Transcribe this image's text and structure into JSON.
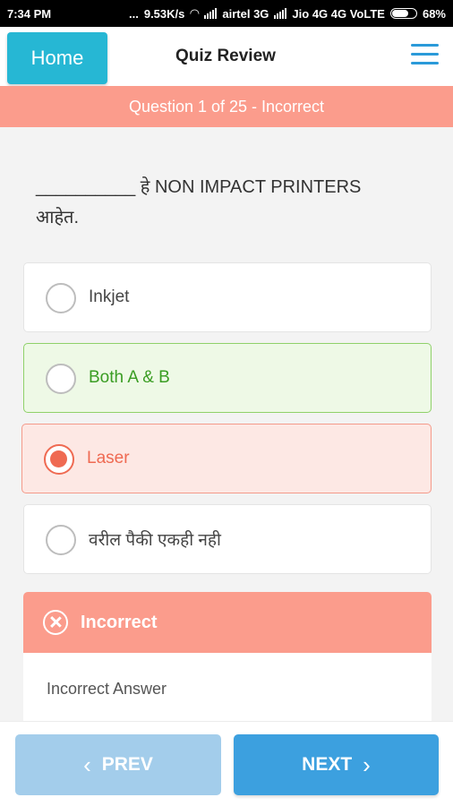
{
  "status_bar": {
    "time": "7:34 PM",
    "dots": "...",
    "speed": "9.53K/s",
    "carrier1": "airtel 3G",
    "carrier2": "Jio 4G 4G VoLTE",
    "battery": "68%"
  },
  "header": {
    "home_label": "Home",
    "title": "Quiz Review",
    "menu_icon": "hamburger-menu-icon"
  },
  "question_banner": "Question 1 of 25 - Incorrect",
  "question": {
    "line1": "__________ हे NON IMPACT PRINTERS",
    "line2": "आहेत."
  },
  "options": [
    {
      "label": "Inkjet",
      "state": "unselected"
    },
    {
      "label": "Both A & B",
      "state": "correct"
    },
    {
      "label": "Laser",
      "state": "selected-wrong"
    },
    {
      "label": "वरील पैकी एकही नही",
      "state": "unselected"
    }
  ],
  "result": {
    "title": "Incorrect",
    "body": "Incorrect Answer"
  },
  "nav": {
    "prev_label": "PREV",
    "next_label": "NEXT"
  },
  "colors": {
    "home_button": "#26b7d4",
    "banner": "#fb9c8c",
    "correct": "#3a9d23",
    "wrong": "#ef6a52",
    "next_button": "#3ca0df",
    "prev_button": "#a3cdeb"
  }
}
